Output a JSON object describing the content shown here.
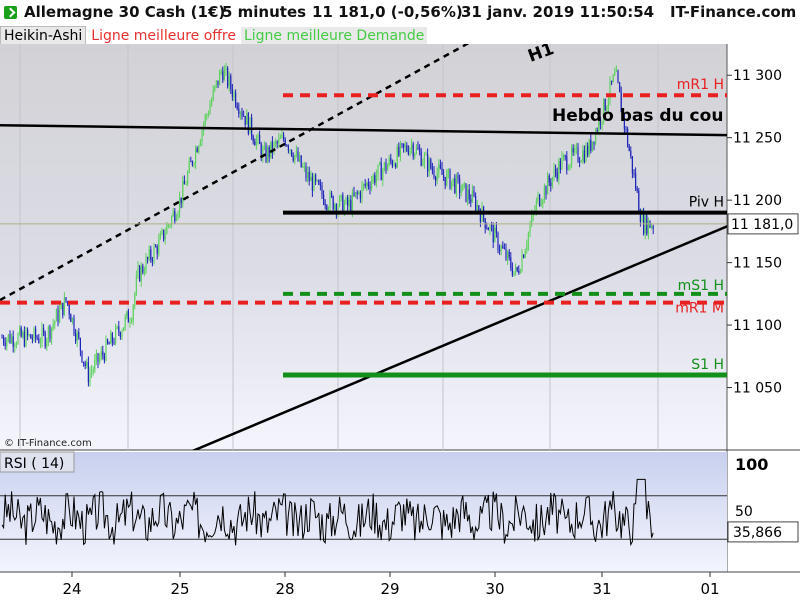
{
  "header": {
    "instrument": "Allemagne 30 Cash (1€)",
    "interval": "5 minutes",
    "quote": "11 181,0 (-0,56%)",
    "datetime": "31 janv. 2019 11:50:54",
    "site": "IT-Finance.com"
  },
  "legend": {
    "heikin": "Heikin-Ashi",
    "offre": "Ligne meilleure offre",
    "demande": "Ligne meilleure Demande"
  },
  "watermark": "© IT-Finance.com",
  "colors": {
    "bull": "#5ed15e",
    "bear": "#1d24b8",
    "resistance": "#e82020",
    "support": "#12901a",
    "trend": "#000000"
  },
  "chart_data": [
    {
      "type": "candlestick",
      "style": "Heikin-Ashi",
      "ylim": [
        11000,
        11325
      ],
      "y_ticks": [
        11050,
        11100,
        11150,
        11200,
        11250,
        11300
      ],
      "y_tick_labels": [
        "11 050",
        "11 100",
        "11 150",
        "11 200",
        "11 250",
        "11 300"
      ],
      "x_tick_labels": [
        "24",
        "25",
        "28",
        "29",
        "30",
        "31",
        "01"
      ],
      "last_price": 11181.0,
      "last_price_label": "11 181,0",
      "close_path": [
        [
          "24",
          11090
        ],
        [
          "24",
          11120
        ],
        [
          "24",
          11060
        ],
        [
          "24",
          11085
        ],
        [
          "24",
          11110
        ],
        [
          "25",
          11140
        ],
        [
          "25",
          11165
        ],
        [
          "25",
          11200
        ],
        [
          "25",
          11255
        ],
        [
          "25",
          11305
        ],
        [
          "28",
          11270
        ],
        [
          "28",
          11235
        ],
        [
          "28",
          11250
        ],
        [
          "28",
          11220
        ],
        [
          "28",
          11200
        ],
        [
          "29",
          11195
        ],
        [
          "29",
          11215
        ],
        [
          "29",
          11230
        ],
        [
          "29",
          11245
        ],
        [
          "29",
          11225
        ],
        [
          "30",
          11215
        ],
        [
          "30",
          11200
        ],
        [
          "30",
          11170
        ],
        [
          "30",
          11140
        ],
        [
          "30",
          11200
        ],
        [
          "31",
          11230
        ],
        [
          "31",
          11240
        ],
        [
          "31",
          11300
        ],
        [
          "31",
          11181
        ]
      ],
      "levels": [
        {
          "label": "mR1 H",
          "value": 11284,
          "style": "dashed",
          "color": "#e82020"
        },
        {
          "label": "Piv H",
          "value": 11190,
          "style": "solid",
          "color": "#000000"
        },
        {
          "label": "mS1 H",
          "value": 11125,
          "style": "dashed",
          "color": "#12901a"
        },
        {
          "label": "mR1 M",
          "value": 11118,
          "style": "dashed",
          "color": "#e82020"
        },
        {
          "label": "S1 H",
          "value": 11060,
          "style": "solid",
          "color": "#12901a"
        }
      ],
      "trendlines": [
        {
          "label": "H1",
          "style": "dashed",
          "from": [
            "24",
            11120
          ],
          "to": [
            "30",
            11390
          ]
        },
        {
          "label": "Hebdo bas du cou",
          "style": "solid",
          "from": [
            "24",
            11260
          ],
          "to": [
            "01",
            11252
          ]
        },
        {
          "label": "",
          "style": "solid",
          "from": [
            "25",
            10995
          ],
          "to": [
            "01",
            11180
          ]
        }
      ]
    },
    {
      "type": "line",
      "title": "RSI ( 14)",
      "ylim": [
        0,
        100
      ],
      "y_tick_labels": [
        "100",
        "50"
      ],
      "reference_lines": [
        70,
        30
      ],
      "last_value": 35.866,
      "last_value_label": "35,866"
    }
  ]
}
